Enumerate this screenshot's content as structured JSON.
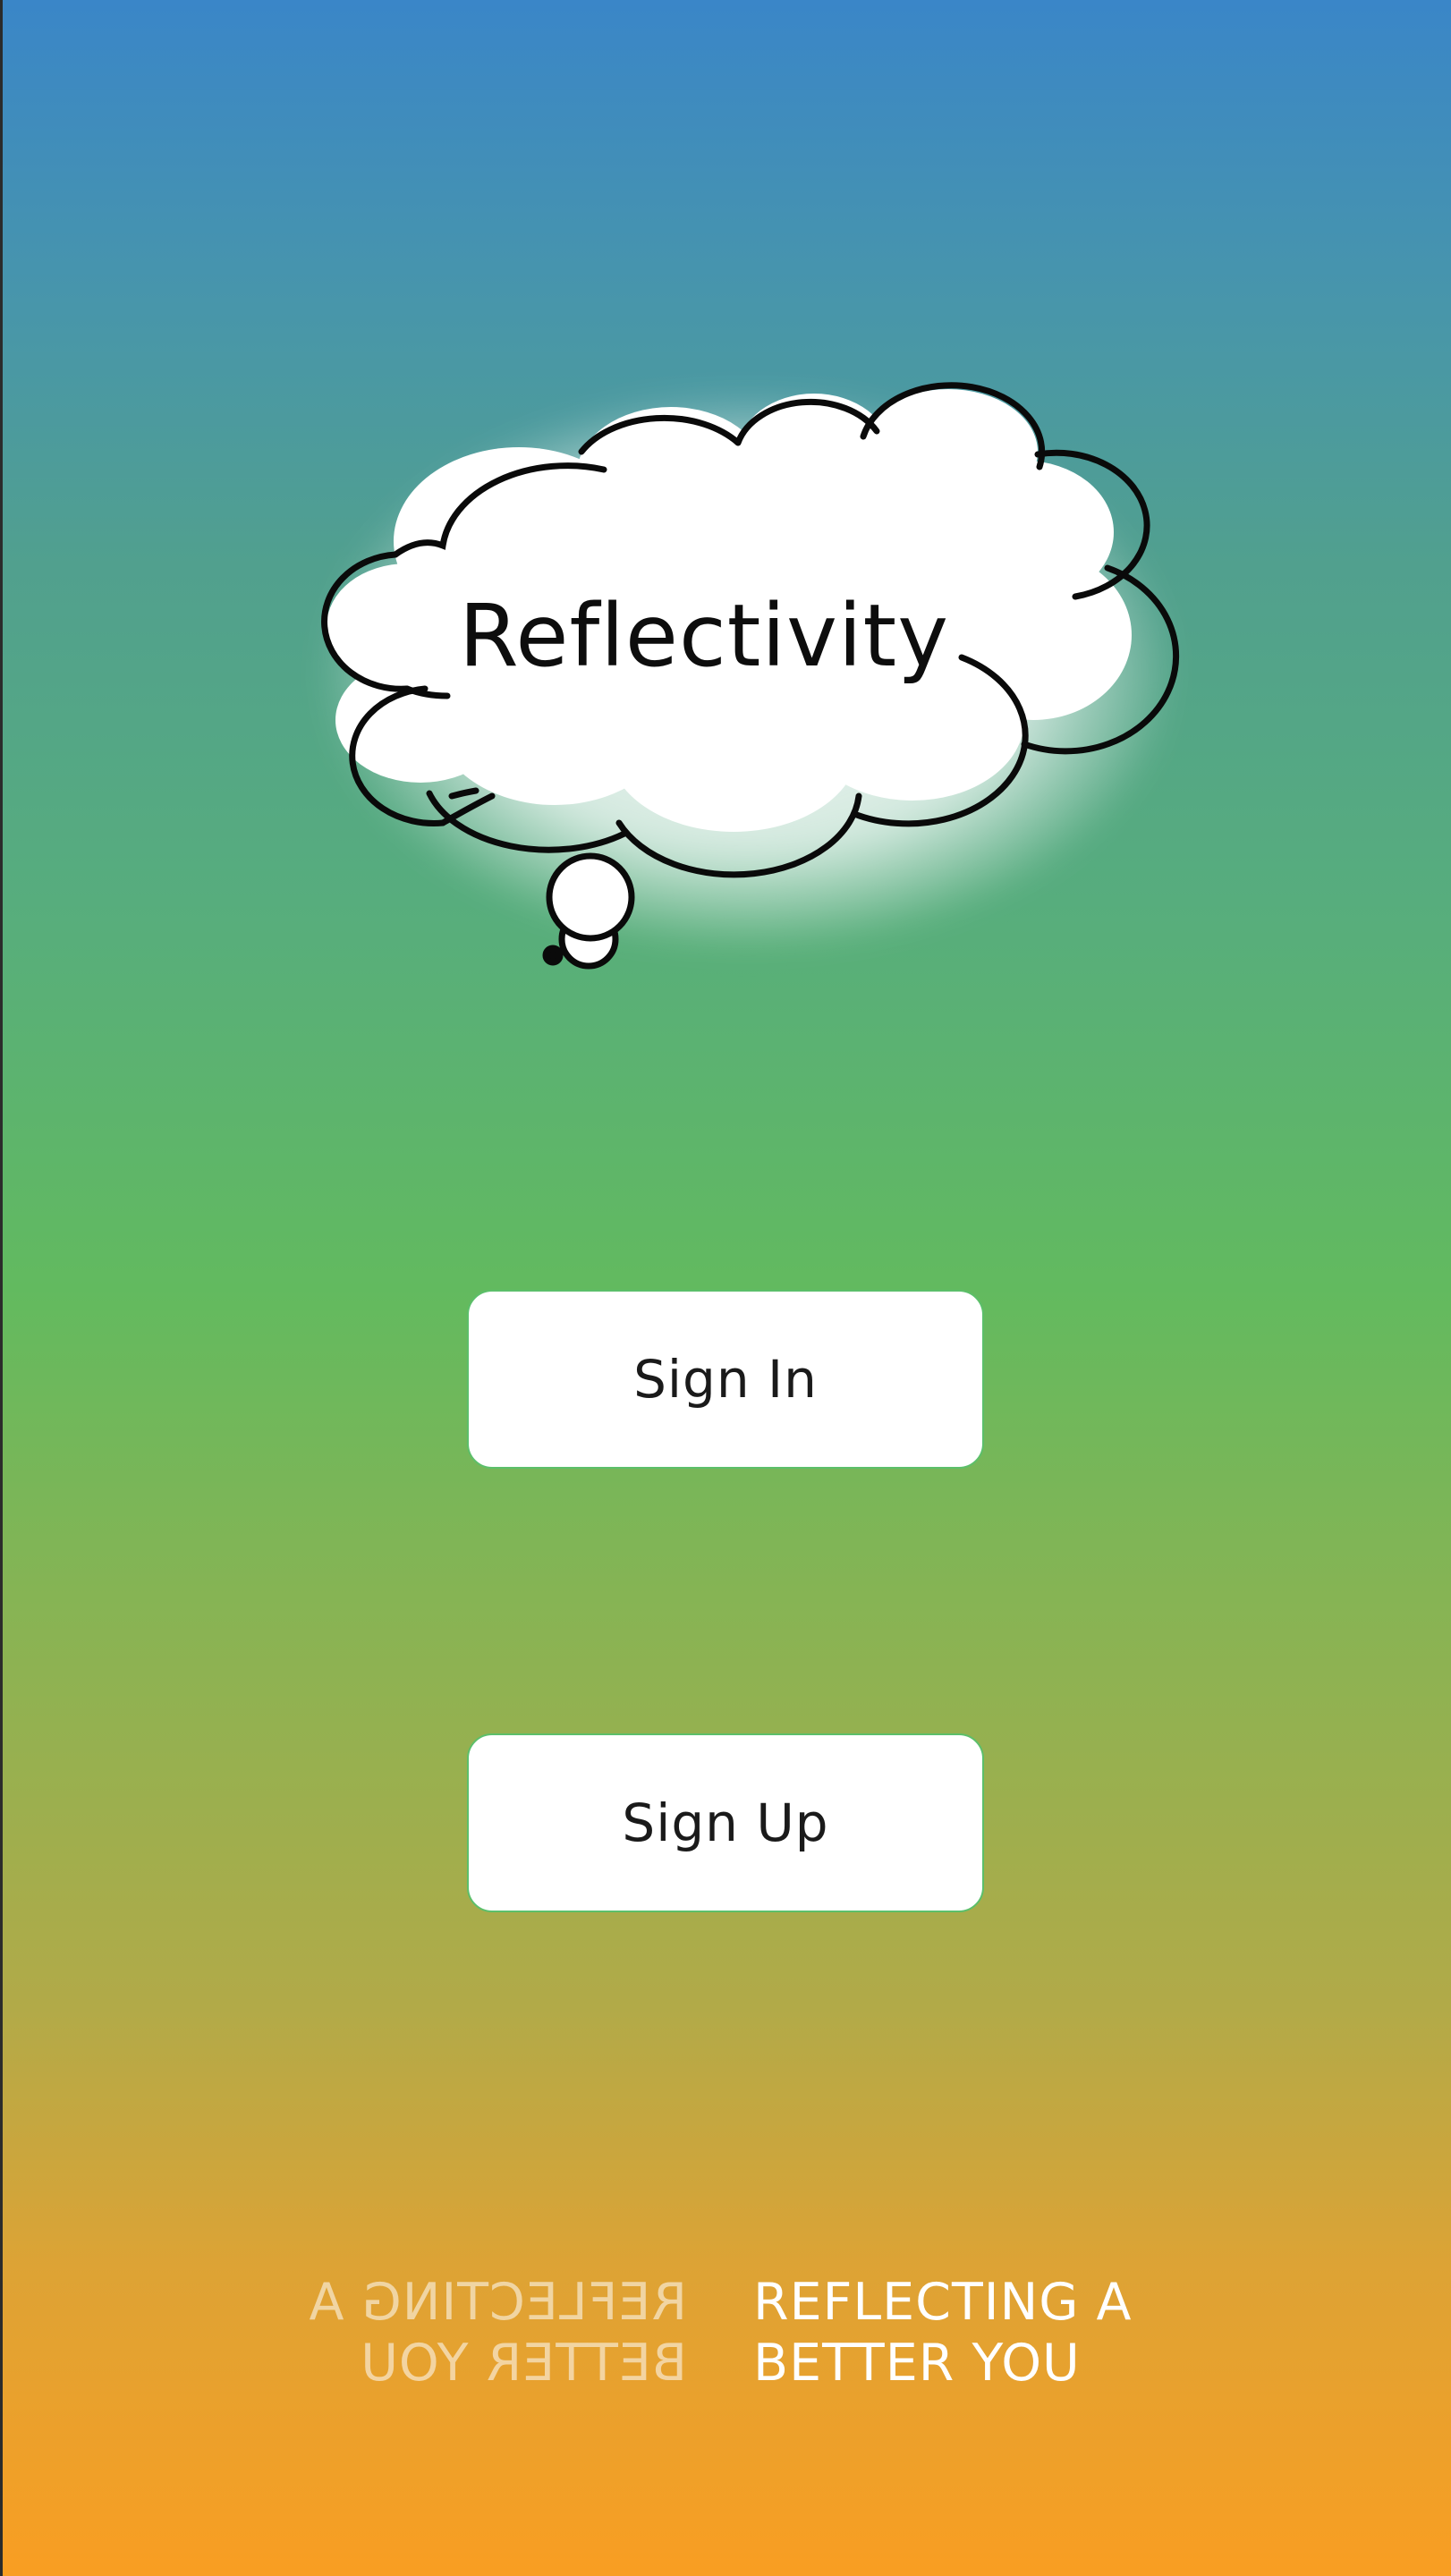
{
  "app": {
    "title": "Reflectivity"
  },
  "buttons": {
    "sign_in_label": "Sign In",
    "sign_up_label": "Sign Up"
  },
  "tagline": {
    "line1": "REFLECTING A",
    "line2": "BETTER YOU"
  },
  "colors": {
    "gradient_top": "#3a86c8",
    "gradient_middle": "#62ba5f",
    "gradient_bottom": "#f99e22",
    "button_background": "#ffffff",
    "button_border": "#5cbf6a"
  },
  "icons": {
    "logo": "thought-cloud-icon"
  }
}
